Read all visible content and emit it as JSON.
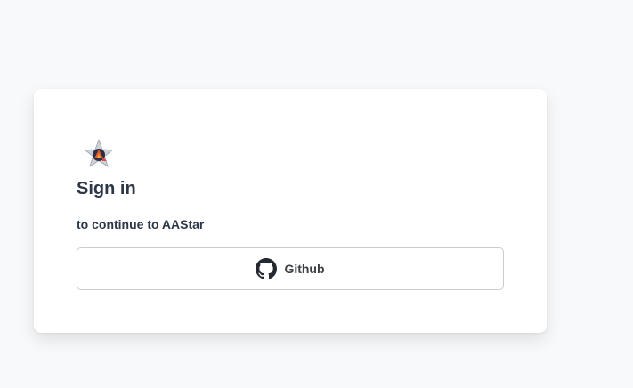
{
  "signin": {
    "logo_icon": "aastar-logo-icon",
    "title": "Sign in",
    "subtitle": "to continue to AAStar",
    "providers": [
      {
        "label": "Github",
        "icon": "github-icon"
      }
    ]
  },
  "colors": {
    "page_background": "#f8f9fa",
    "card_background": "#ffffff",
    "text": "#2d3748",
    "button_border": "#c9ccd1"
  }
}
